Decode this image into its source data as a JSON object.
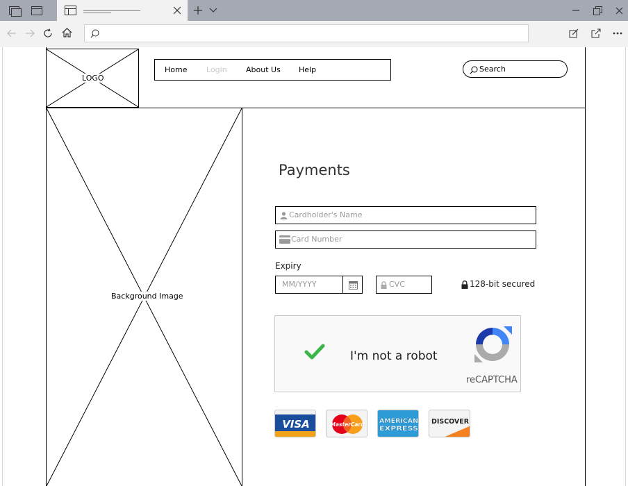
{
  "page": {
    "logo_label": "LOGO",
    "nav": [
      "Home",
      "Login",
      "About Us",
      "Help"
    ],
    "search_label": "Search",
    "hero_label": "Background Image",
    "title": "Payments",
    "cardholder_placeholder": "Cardholder's Name",
    "card_number_placeholder": "Card Number",
    "expiry_label": "Expiry",
    "expiry_placeholder": "MM/YYYY",
    "cvc_placeholder": "CVC",
    "secured_text": "128-bit secured",
    "captcha_text": "I'm not a robot",
    "captcha_brand": "reCAPTCHA",
    "cards": [
      "VISA",
      "MasterCard",
      "AMERICAN EXPRESS",
      "DISCOVER"
    ]
  },
  "colors": {
    "chrome_dark": "#a4a9b3",
    "chrome_light": "#f2f2f2",
    "check_green": "#3cb54a",
    "visa_blue": "#1a4e9c",
    "visa_gold": "#f3a31b",
    "amex_blue": "#2d9bd6",
    "discover_orange": "#f48120"
  },
  "icons": [
    "tab-stack-icon",
    "window-icon",
    "tab-page-icon",
    "close-icon",
    "plus-icon",
    "chevron-down-icon",
    "minimize-icon",
    "restore-icon",
    "back-icon",
    "forward-icon",
    "refresh-icon",
    "home-icon",
    "search-icon",
    "edit-icon",
    "share-icon",
    "more-icon",
    "user-icon",
    "credit-card-icon",
    "calendar-icon",
    "lock-icon",
    "checkmark-icon",
    "recaptcha-icon"
  ]
}
